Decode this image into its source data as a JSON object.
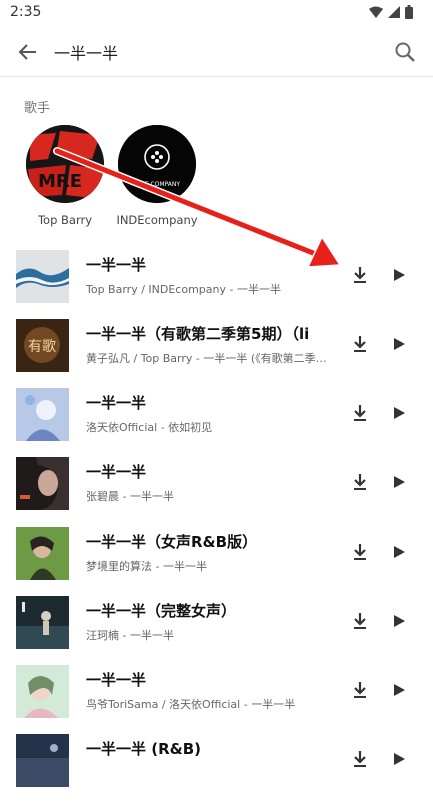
{
  "status": {
    "time": "2:35"
  },
  "search": {
    "query": "一半一半"
  },
  "artists_section": {
    "title": "歌手",
    "artists": [
      {
        "name": "Top Barry",
        "avatar_text": "MRE"
      },
      {
        "name": "INDEcompany",
        "avatar_text": "INDE COMPANY"
      }
    ]
  },
  "songs": [
    {
      "title": "一半一半",
      "subtitle": "Top Barry / INDEcompany - 一半一半"
    },
    {
      "title": "一半一半（有歌第二季第5期）（li",
      "subtitle": "黄子弘凡 / Top Barry - 一半一半 (《有歌第二季…",
      "cover_text": "有歌"
    },
    {
      "title": "一半一半",
      "subtitle": "洛天依Official - 依如初见"
    },
    {
      "title": "一半一半",
      "subtitle": "张碧晨 - 一半一半"
    },
    {
      "title": "一半一半（女声R&B版）",
      "subtitle": "梦境里的算法 - 一半一半"
    },
    {
      "title": "一半一半（完整女声）",
      "subtitle": "汪珂楠 - 一半一半"
    },
    {
      "title": "一半一半",
      "subtitle": "鸟爷ToriSama / 洛天依Official - 一半一半"
    },
    {
      "title": "一半一半 (R&B)",
      "subtitle": ""
    }
  ],
  "colors": {
    "accent_arrow": "#e8201c",
    "icon": "#333333"
  },
  "icons": [
    "wifi-icon",
    "signal-icon",
    "battery-icon",
    "back-arrow-icon",
    "search-icon",
    "download-icon",
    "play-icon"
  ]
}
